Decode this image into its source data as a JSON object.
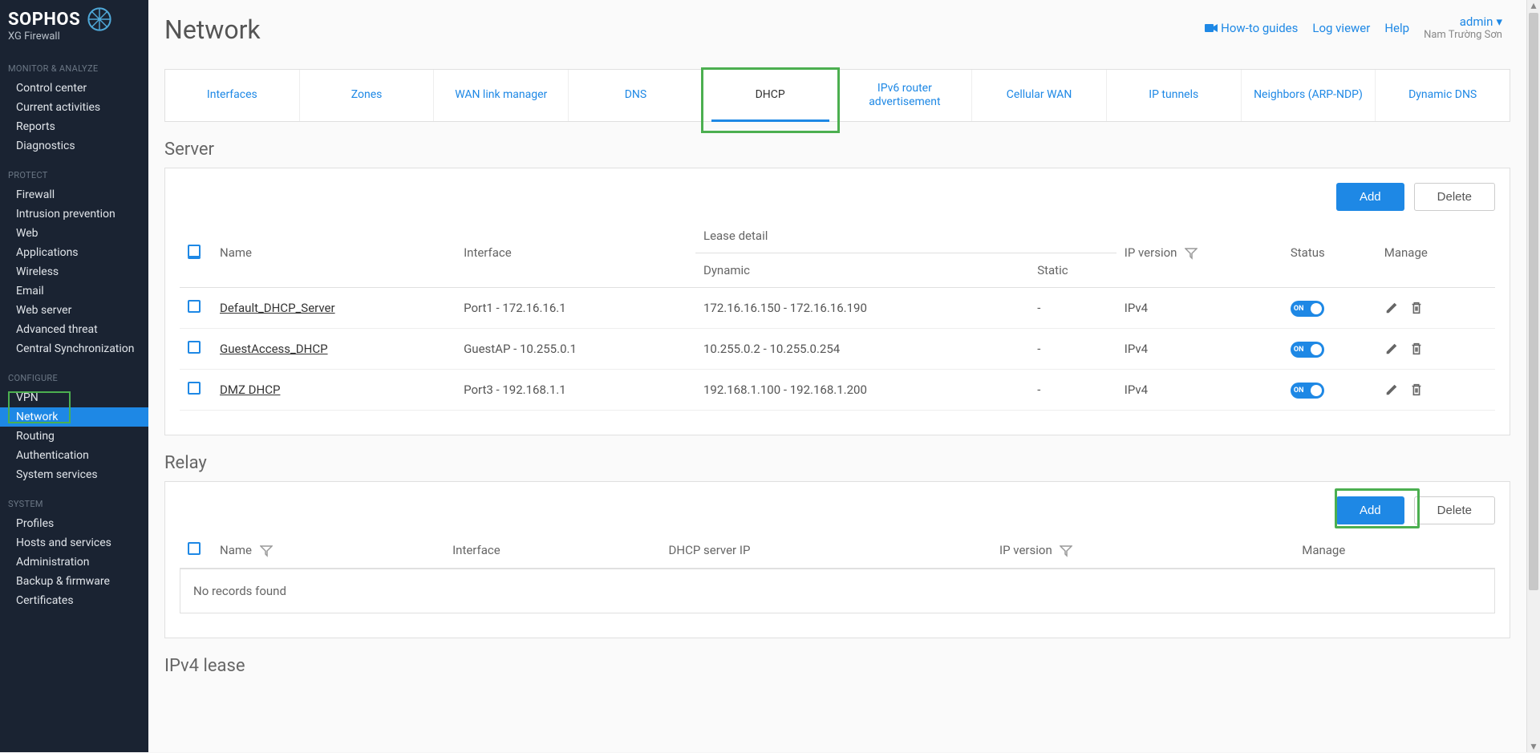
{
  "brand": {
    "name": "SOPHOS",
    "sub": "XG Firewall"
  },
  "sidebar": {
    "sections": [
      {
        "label": "MONITOR & ANALYZE",
        "items": [
          "Control center",
          "Current activities",
          "Reports",
          "Diagnostics"
        ]
      },
      {
        "label": "PROTECT",
        "items": [
          "Firewall",
          "Intrusion prevention",
          "Web",
          "Applications",
          "Wireless",
          "Email",
          "Web server",
          "Advanced threat",
          "Central Synchronization"
        ]
      },
      {
        "label": "CONFIGURE",
        "items": [
          "VPN",
          "Network",
          "Routing",
          "Authentication",
          "System services"
        ]
      },
      {
        "label": "SYSTEM",
        "items": [
          "Profiles",
          "Hosts and services",
          "Administration",
          "Backup & firmware",
          "Certificates"
        ]
      }
    ],
    "active": "Network"
  },
  "header": {
    "title": "Network",
    "links": {
      "howto": "How-to guides",
      "logviewer": "Log viewer",
      "help": "Help",
      "admin": "admin",
      "admin_sub": "Nam Trường Sơn"
    }
  },
  "tabs": [
    "Interfaces",
    "Zones",
    "WAN link manager",
    "DNS",
    "DHCP",
    "IPv6 router advertisement",
    "Cellular WAN",
    "IP tunnels",
    "Neighbors (ARP-NDP)",
    "Dynamic DNS"
  ],
  "active_tab": "DHCP",
  "server": {
    "title": "Server",
    "buttons": {
      "add": "Add",
      "delete": "Delete"
    },
    "columns": {
      "name": "Name",
      "interface": "Interface",
      "lease": "Lease detail",
      "dynamic": "Dynamic",
      "static": "Static",
      "ipversion": "IP version",
      "status": "Status",
      "manage": "Manage"
    },
    "rows": [
      {
        "name": "Default_DHCP_Server",
        "interface": "Port1 - 172.16.16.1",
        "dynamic": "172.16.16.150 - 172.16.16.190",
        "static": "-",
        "ipversion": "IPv4",
        "status": "ON"
      },
      {
        "name": "GuestAccess_DHCP",
        "interface": "GuestAP - 10.255.0.1",
        "dynamic": "10.255.0.2 - 10.255.0.254",
        "static": "-",
        "ipversion": "IPv4",
        "status": "ON"
      },
      {
        "name": "DMZ DHCP",
        "interface": "Port3 - 192.168.1.1",
        "dynamic": "192.168.1.100 - 192.168.1.200",
        "static": "-",
        "ipversion": "IPv4",
        "status": "ON"
      }
    ]
  },
  "relay": {
    "title": "Relay",
    "buttons": {
      "add": "Add",
      "delete": "Delete"
    },
    "columns": {
      "name": "Name",
      "interface": "Interface",
      "dhcpip": "DHCP server IP",
      "ipversion": "IP version",
      "manage": "Manage"
    },
    "empty": "No records found"
  },
  "lease": {
    "title": "IPv4 lease"
  }
}
